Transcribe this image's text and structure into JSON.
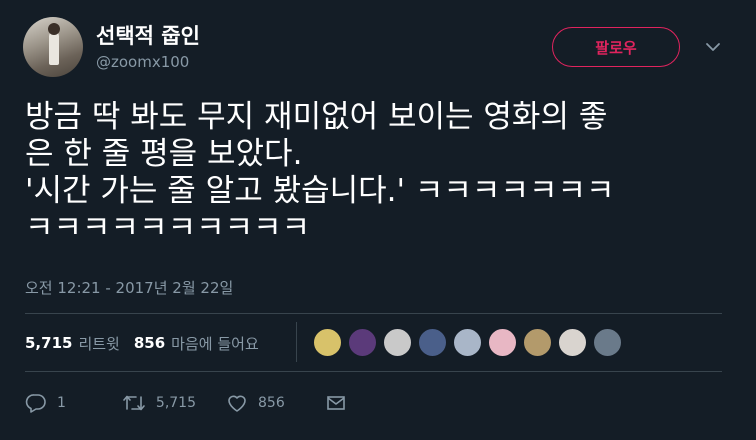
{
  "user": {
    "display_name": "선택적 줍인",
    "handle": "@zoomx100",
    "follow_label": "팔로우"
  },
  "tweet": {
    "lines": [
      "방금 딱 봐도 무지 재미없어 보이는 영화의 좋",
      "은 한 줄 평을 보았다.",
      "'시간 가는 줄 알고 봤습니다.' ㅋㅋㅋㅋㅋㅋㅋ",
      "ㅋㅋㅋㅋㅋㅋㅋㅋㅋㅋ"
    ],
    "timestamp": "오전 12:21 - 2017년 2월 22일"
  },
  "stats": {
    "retweets_count": "5,715",
    "retweets_label": "리트윗",
    "likes_count": "856",
    "likes_label": "마음에 들어요"
  },
  "likers": [
    {
      "color": "#d8c26a"
    },
    {
      "color": "#5b3a7a"
    },
    {
      "color": "#c9c9c9"
    },
    {
      "color": "#4a5f8a"
    },
    {
      "color": "#a9b6c8"
    },
    {
      "color": "#e8b7c4"
    },
    {
      "color": "#b39a6b"
    },
    {
      "color": "#d9d4cf"
    },
    {
      "color": "#6a7a8a"
    }
  ],
  "actions": {
    "reply_count": "1",
    "retweet_count": "5,715",
    "like_count": "856"
  },
  "icons": [
    "reply-icon",
    "retweet-icon",
    "heart-icon",
    "direct-message-icon",
    "chevron-down-icon"
  ],
  "colors": {
    "background": "#141d26",
    "follow_accent": "#e0245e",
    "secondary_text": "#8899a6"
  }
}
